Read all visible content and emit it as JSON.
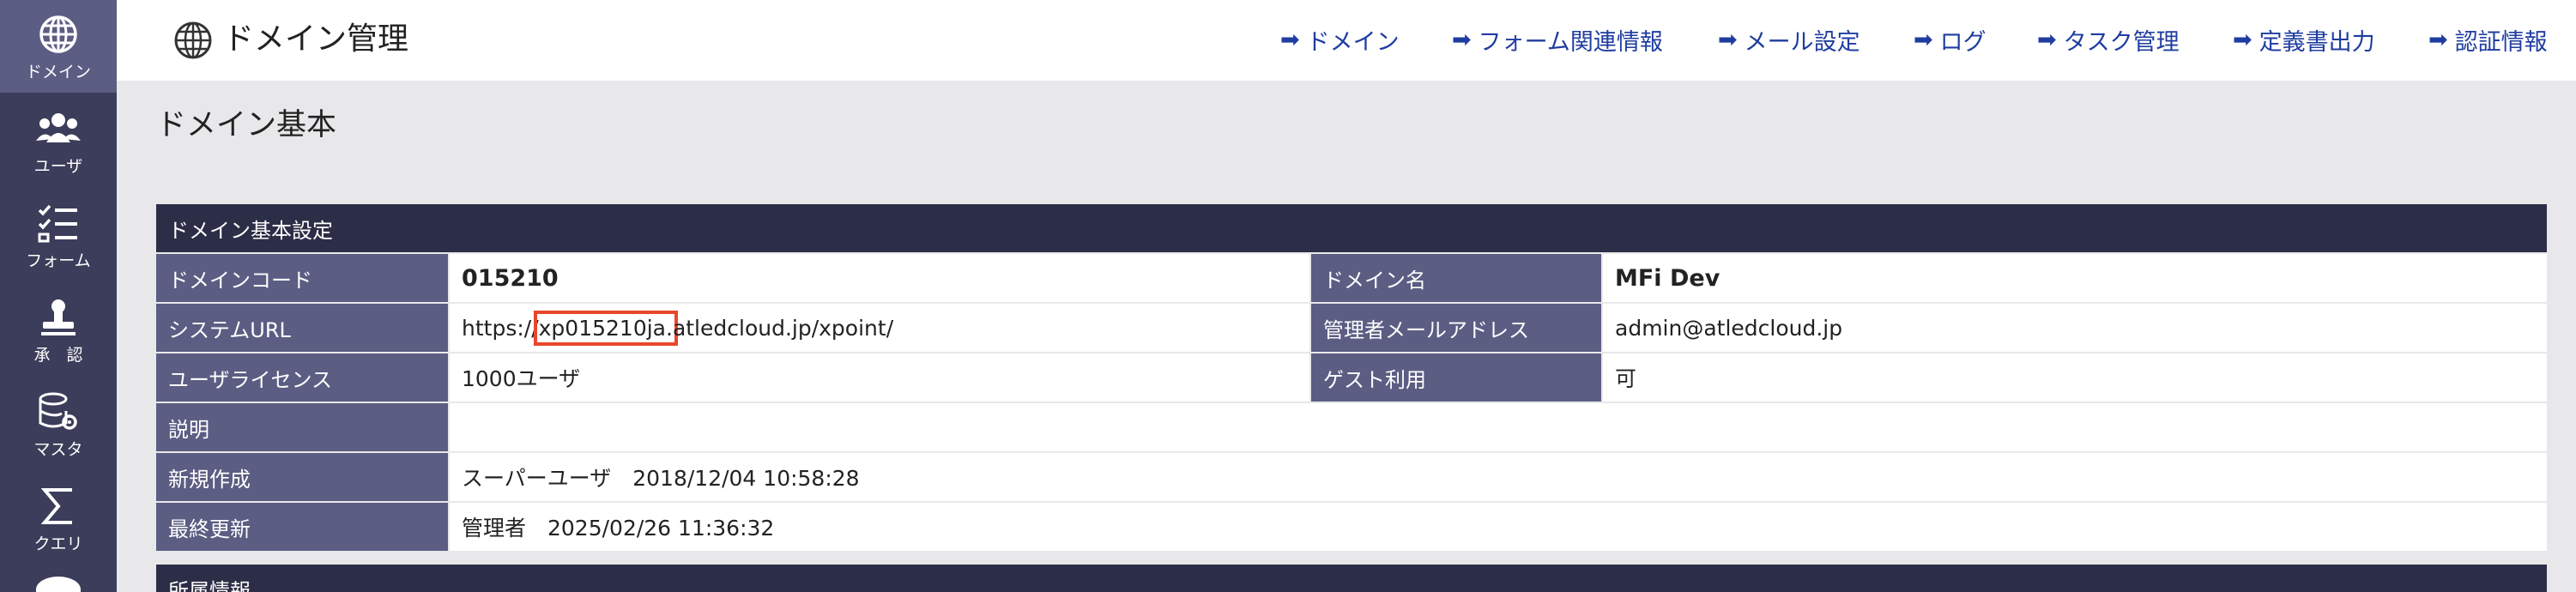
{
  "sidebar": {
    "items": [
      {
        "label": "ドメイン",
        "icon": "globe-icon",
        "active": true
      },
      {
        "label": "ユーザ",
        "icon": "users-icon"
      },
      {
        "label": "フォーム",
        "icon": "form-checklist-icon"
      },
      {
        "label": "承　認",
        "icon": "stamp-icon"
      },
      {
        "label": "マスタ",
        "icon": "database-gear-icon"
      },
      {
        "label": "クエリ",
        "icon": "sigma-icon"
      }
    ]
  },
  "header": {
    "title": "ドメイン管理",
    "icon": "globe-icon",
    "nav": [
      {
        "arrow": "➡",
        "label": "ドメイン"
      },
      {
        "arrow": "➡",
        "label": "フォーム関連情報"
      },
      {
        "arrow": "➡",
        "label": "メール設定"
      },
      {
        "arrow": "➡",
        "label": "ログ"
      },
      {
        "arrow": "➡",
        "label": "タスク管理"
      },
      {
        "arrow": "➡",
        "label": "定義書出力"
      },
      {
        "arrow": "➡",
        "label": "認証情報"
      }
    ]
  },
  "main": {
    "page_title": "ドメイン基本",
    "basic_section": {
      "title": "ドメイン基本設定",
      "domain_code_label": "ドメインコード",
      "domain_code_value": "015210",
      "domain_name_label": "ドメイン名",
      "domain_name_value": "MFi Dev",
      "system_url_label": "システムURL",
      "system_url_prefix": "https://",
      "system_url_highlight": "xp015210ja.",
      "system_url_suffix": "atledcloud.jp/xpoint/",
      "admin_email_label": "管理者メールアドレス",
      "admin_email_value": "admin@atledcloud.jp",
      "user_license_label": "ユーザライセンス",
      "user_license_value": "1000ユーザ",
      "guest_label": "ゲスト利用",
      "guest_value": "可",
      "description_label": "説明",
      "description_value": "",
      "created_label": "新規作成",
      "created_value": "スーパーユーザ　2018/12/04 10:58:28",
      "updated_label": "最終更新",
      "updated_value": "管理者　2025/02/26 11:36:32"
    },
    "next_section_title": "所属情報"
  },
  "colors": {
    "sidebar_bg": "#3b3d5a",
    "sidebar_active": "#5b5d83",
    "label_bg": "#5b5d83",
    "section_header_bg": "#2c2d46",
    "link": "#1f3da0",
    "highlight_border": "#e8472c"
  }
}
